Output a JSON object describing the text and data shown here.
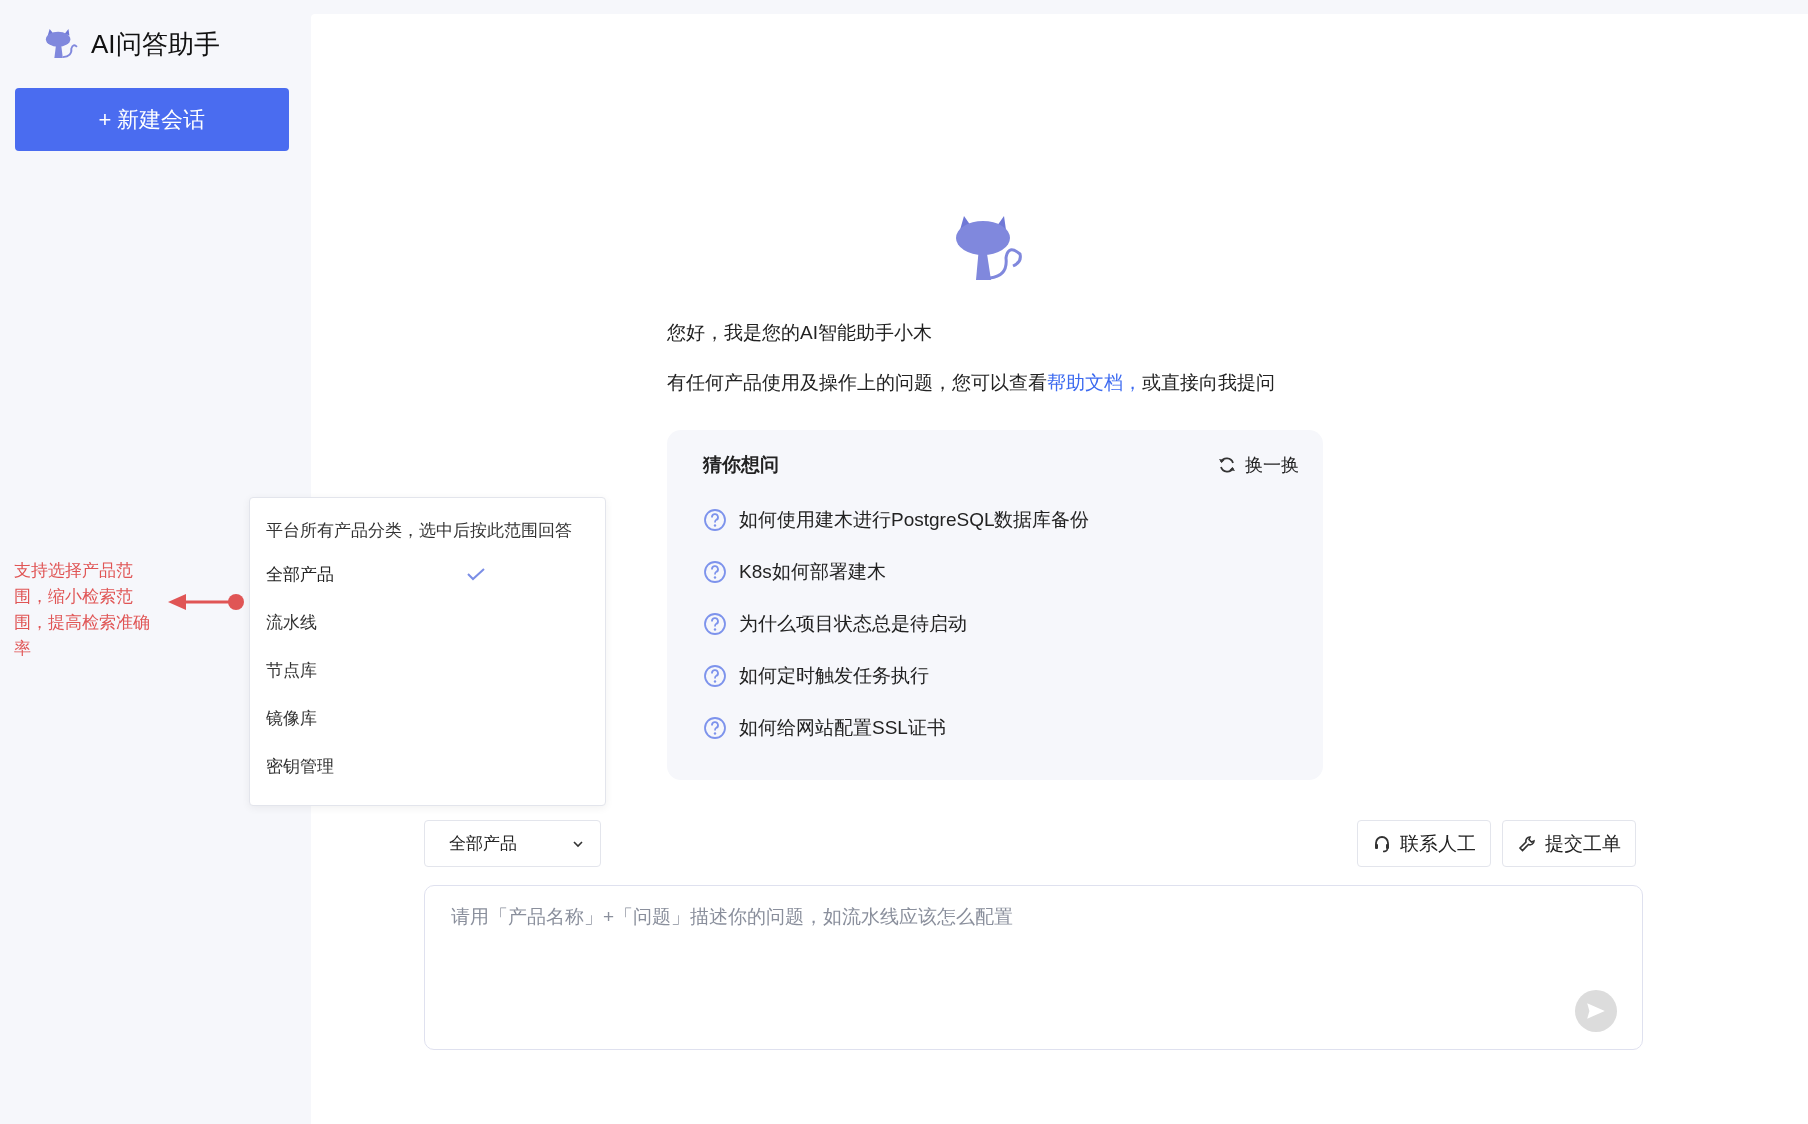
{
  "sidebar": {
    "app_title": "AI问答助手",
    "new_chat_button": "+ 新建会话"
  },
  "welcome": {
    "greeting": "您好，我是您的AI智能助手小木",
    "intro": "有任何产品使用及操作上的问题，您可以查看",
    "intro_link": "帮助文档，",
    "intro_end": "或直接向我提问"
  },
  "suggestions": {
    "title": "猜你想问",
    "refresh_label": "换一换",
    "questions": [
      "如何使用建木进行PostgreSQL数据库备份",
      "K8s如何部署建木",
      "为什么项目状态总是待启动",
      "如何定时触发任务执行",
      "如何给网站配置SSL证书"
    ]
  },
  "scope_dropdown": {
    "hint": "平台所有产品分类，选中后按此范围回答",
    "options": [
      {
        "label": "全部产品",
        "selected": true
      },
      {
        "label": "流水线",
        "selected": false
      },
      {
        "label": "节点库",
        "selected": false
      },
      {
        "label": "镜像库",
        "selected": false
      },
      {
        "label": "密钥管理",
        "selected": false
      }
    ]
  },
  "annotation": {
    "text": "支持选择产品范围，缩小检索范围，提高检索准确率"
  },
  "composer": {
    "scope_select": "全部产品",
    "buttons": [
      {
        "kind": "contact",
        "label": "联系人工"
      },
      {
        "kind": "ticket",
        "label": "提交工单"
      }
    ],
    "placeholder": "请用「产品名称」+「问题」描述你的问题，如流水线应该怎么配置"
  }
}
